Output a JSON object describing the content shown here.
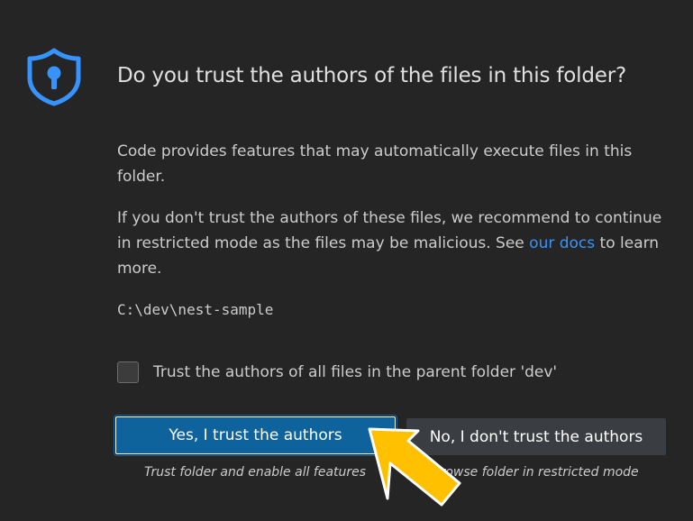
{
  "dialog": {
    "icon": "shield-lock-icon",
    "title": "Do you trust the authors of the files in this folder?",
    "paragraph1": "Code provides features that may automatically execute files in this folder.",
    "paragraph2_before": "If you don't trust the authors of these files, we recommend to continue in restricted mode as the files may be malicious. See ",
    "paragraph2_link": "our docs",
    "paragraph2_after": " to learn more.",
    "folder_path": "C:\\dev\\nest-sample",
    "checkbox_label": "Trust the authors of all files in the parent folder 'dev'",
    "checkbox_checked": false,
    "yes_button_label": "Yes, I trust the authors",
    "yes_button_caption": "Trust folder and enable all features",
    "no_button_label": "No, I don't trust the authors",
    "no_button_caption": "Browse folder in restricted mode"
  },
  "colors": {
    "background": "#252526",
    "accent": "#3794ff",
    "primary_button": "#0e639c",
    "secondary_button": "#3a3d41",
    "pointer_arrow": "#ffc000"
  },
  "overlay": {
    "pointer": "arrow-pointer-icon"
  }
}
